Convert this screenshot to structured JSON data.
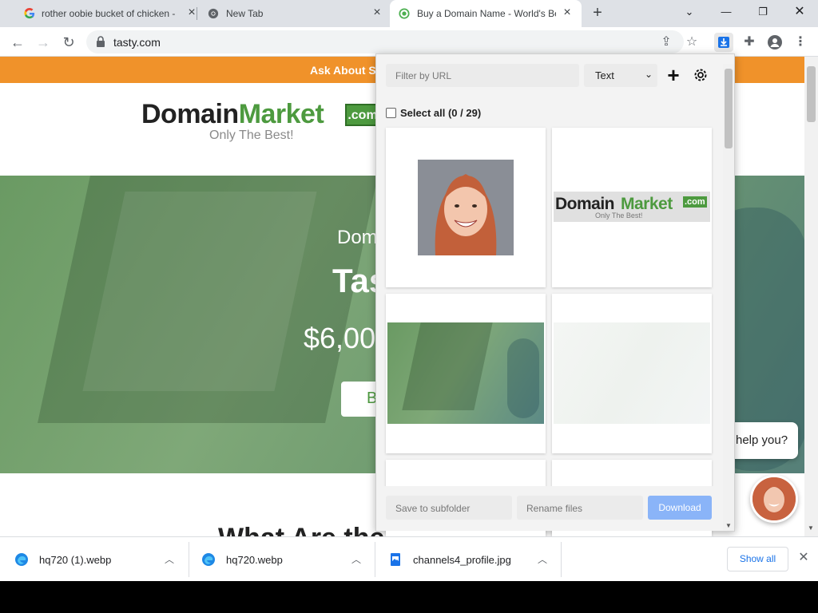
{
  "browser": {
    "tabs": [
      {
        "title": "rother oobie bucket of chicken -",
        "icon": "google-icon"
      },
      {
        "title": "New Tab",
        "icon": "chrome-icon"
      },
      {
        "title": "Buy a Domain Name - World's Be",
        "icon": "green-circle-icon"
      }
    ],
    "new_tab": "+",
    "url": "tasty.com"
  },
  "page": {
    "promo_text": "Ask About S",
    "logo_word_dark": "Domain",
    "logo_word_green": "Market",
    "logo_com": ".com",
    "logo_tagline": "Only The Best!",
    "hero_subtitle": "Dom",
    "hero_title": "Tas",
    "hero_price": "$6,00",
    "hero_button": "B",
    "chat_text": "help you?",
    "section_heading": "What Are the Advant"
  },
  "popup": {
    "filter_placeholder": "Filter by URL",
    "mode_value": "Text",
    "select_all_label": "Select all (0 / 29)",
    "card_logo_word_dark": "Domain",
    "card_logo_word_green": "Market",
    "card_logo_com": ".com",
    "card_logo_tagline": "Only The Best!",
    "subfolder_placeholder": "Save to subfolder",
    "rename_placeholder": "Rename files",
    "download_label": "Download"
  },
  "downloads": {
    "items": [
      {
        "name": "hq720 (1).webp",
        "icon": "edge-icon"
      },
      {
        "name": "hq720.webp",
        "icon": "edge-icon"
      },
      {
        "name": "channels4_profile.jpg",
        "icon": "image-file-icon"
      }
    ],
    "show_all": "Show all"
  },
  "colors": {
    "accent_orange": "#f0922a",
    "brand_green": "#4d9a3f",
    "download_blue": "#8ab4f8"
  }
}
